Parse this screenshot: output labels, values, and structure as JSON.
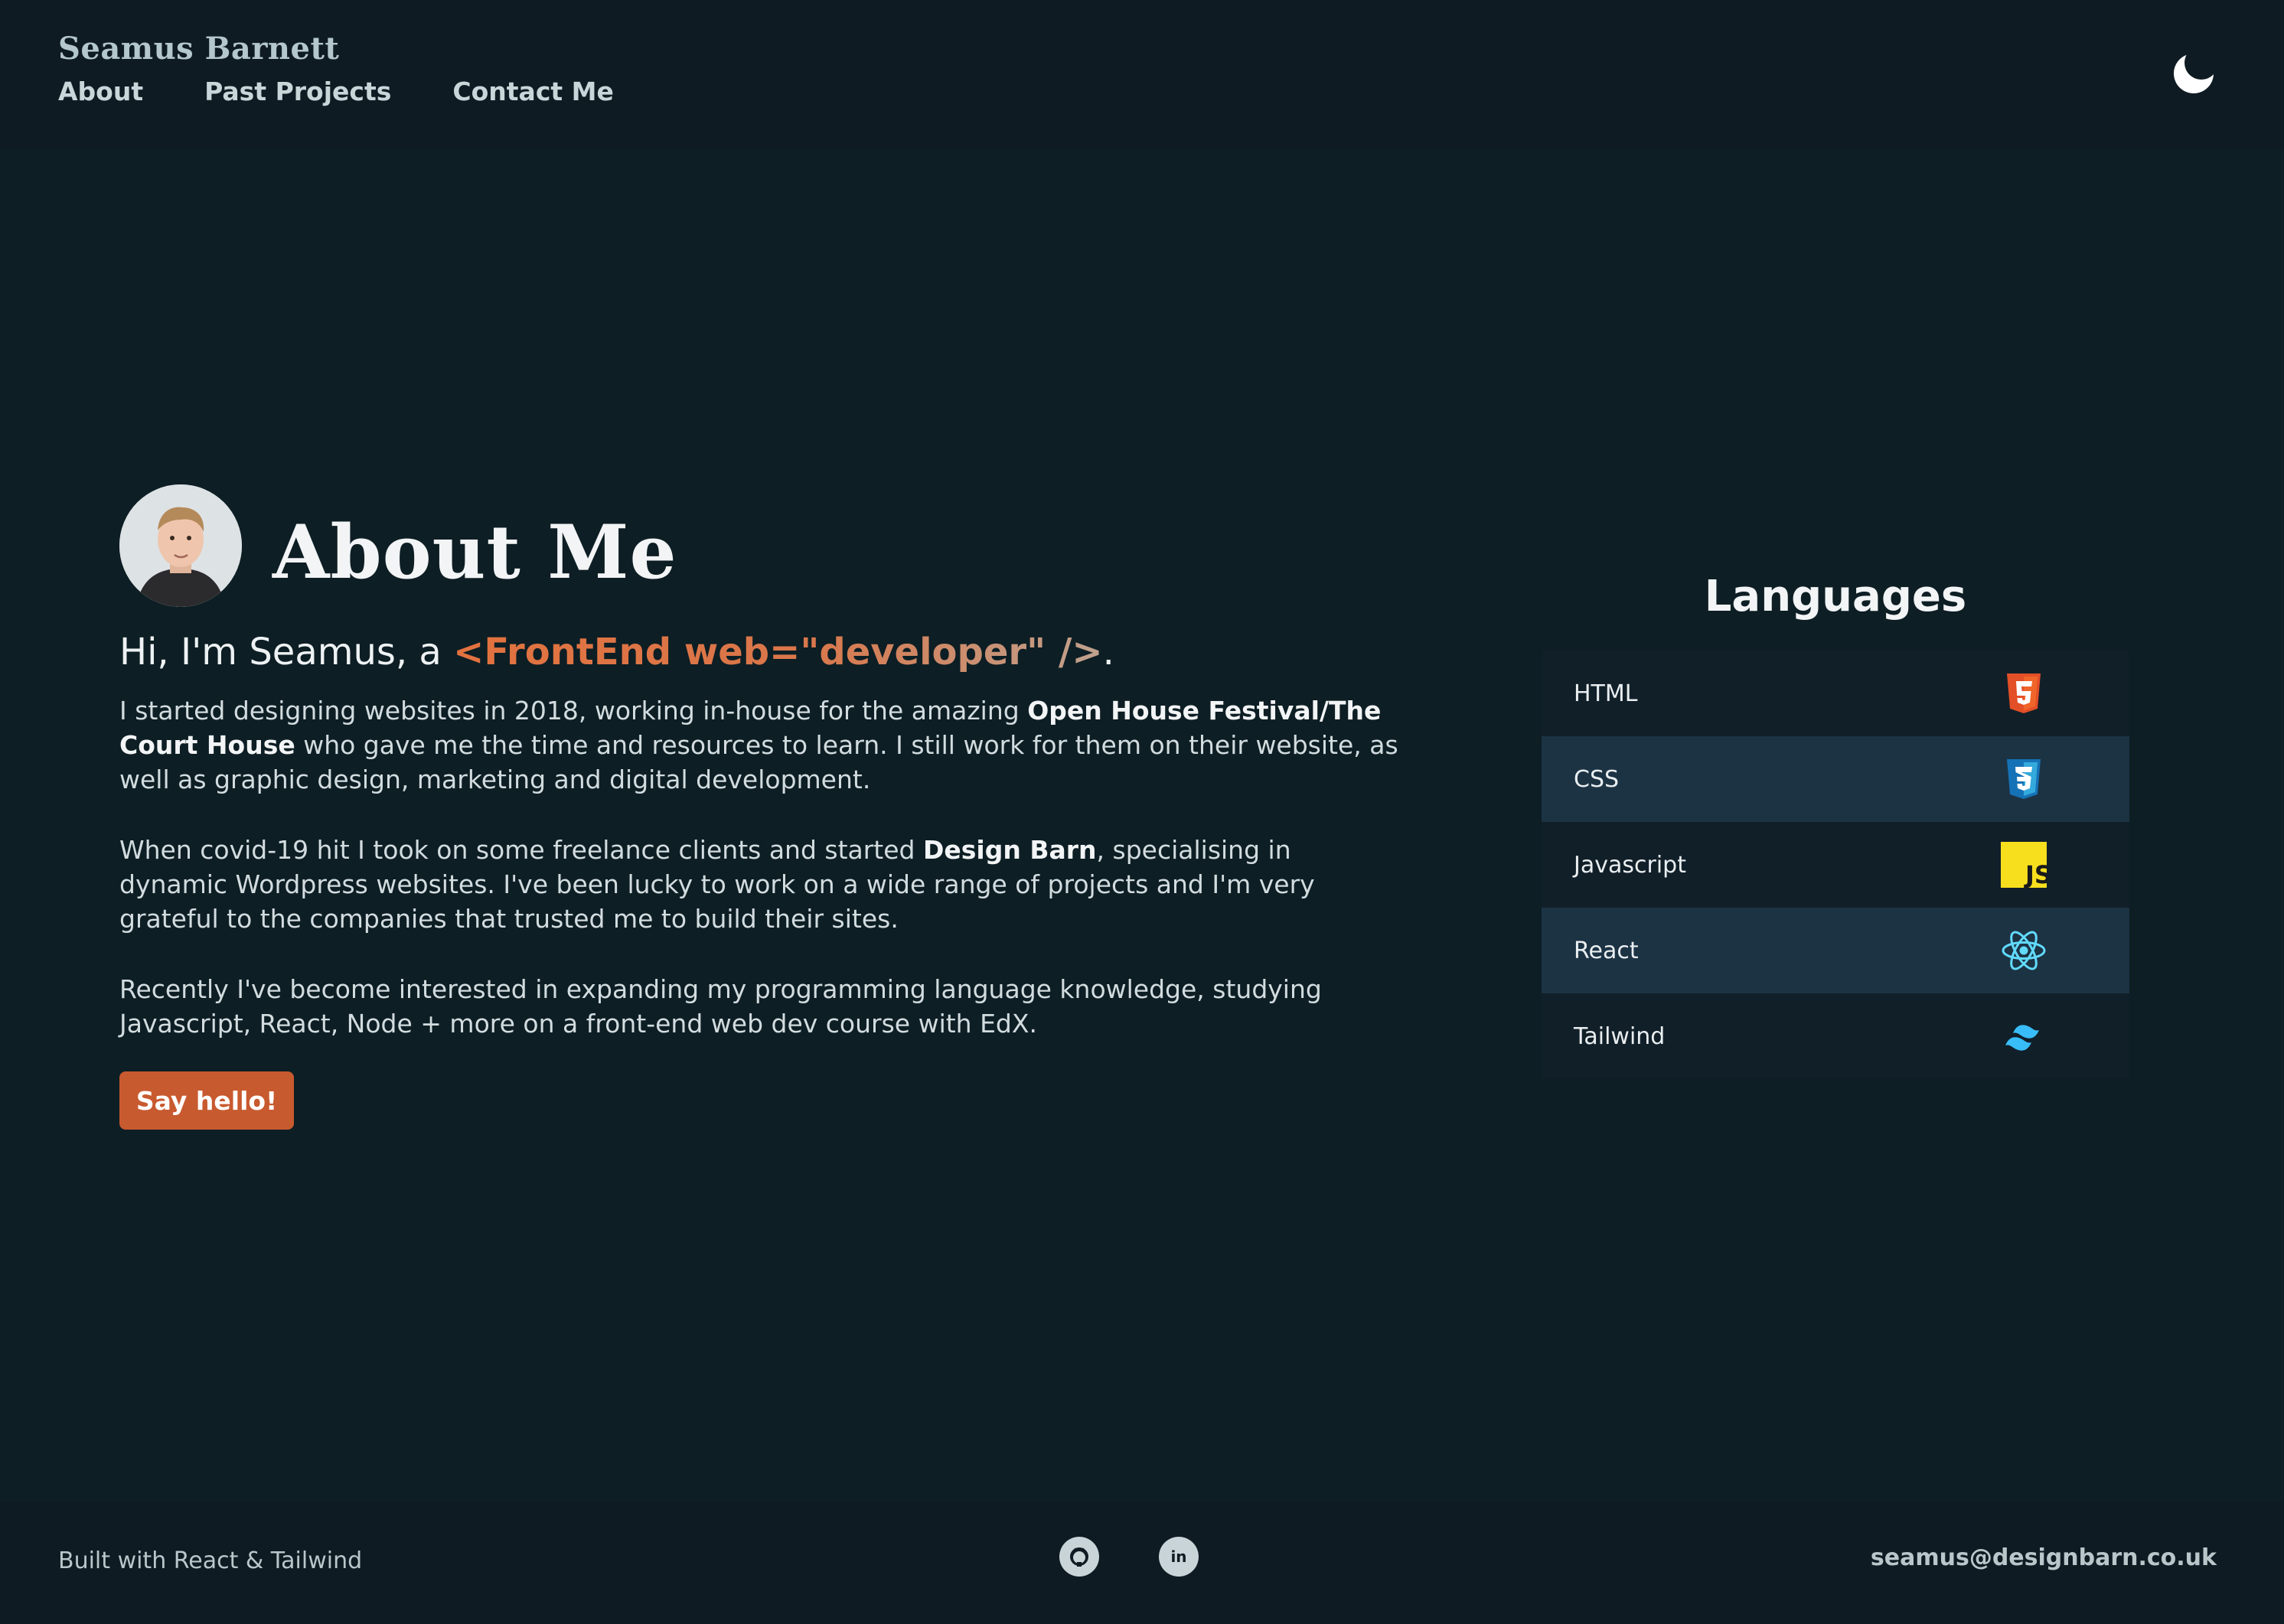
{
  "header": {
    "brand": "Seamus Barnett",
    "nav": [
      "About",
      "Past Projects",
      "Contact Me"
    ],
    "theme_icon": "moon-icon"
  },
  "about": {
    "title": "About Me",
    "intro_prefix": "Hi, I'm Seamus, a ",
    "intro_code": "<FrontEnd web=\"developer\" />",
    "intro_suffix": ".",
    "bio1": [
      "I started designing websites in 2018, working in-house for the amazing ",
      "Open House Festival/The Court House",
      " who gave me the time and resources to learn. I still work for them on their website, as well as graphic design, marketing and digital development."
    ],
    "bio2": [
      "When covid-19 hit I took on some freelance clients and started ",
      "Design Barn",
      ", specialising in dynamic Wordpress websites. I've been lucky to work on a wide range of projects and I'm very grateful to the companies that trusted me to build their sites."
    ],
    "bio3": "Recently I've become interested in expanding my programming language knowledge, studying Javascript, React, Node + more on a front-end web dev course with EdX.",
    "cta": "Say hello!"
  },
  "languages": {
    "title": "Languages",
    "items": [
      {
        "name": "HTML",
        "icon": "html5-icon"
      },
      {
        "name": "CSS",
        "icon": "css3-icon"
      },
      {
        "name": "Javascript",
        "icon": "javascript-icon"
      },
      {
        "name": "React",
        "icon": "react-icon"
      },
      {
        "name": "Tailwind",
        "icon": "tailwind-icon"
      }
    ]
  },
  "footer": {
    "built_with": "Built with React & Tailwind",
    "social_icons": [
      "github-icon",
      "linkedin-icon"
    ],
    "linkedin_glyph": "in",
    "email": "seamus@designbarn.co.uk"
  },
  "colors": {
    "background": "#0d1e24",
    "header_footer": "#0f1b22",
    "accent_orange": "#c85a2f",
    "row_dark": "#111f29",
    "row_alt": "#1c3344"
  }
}
